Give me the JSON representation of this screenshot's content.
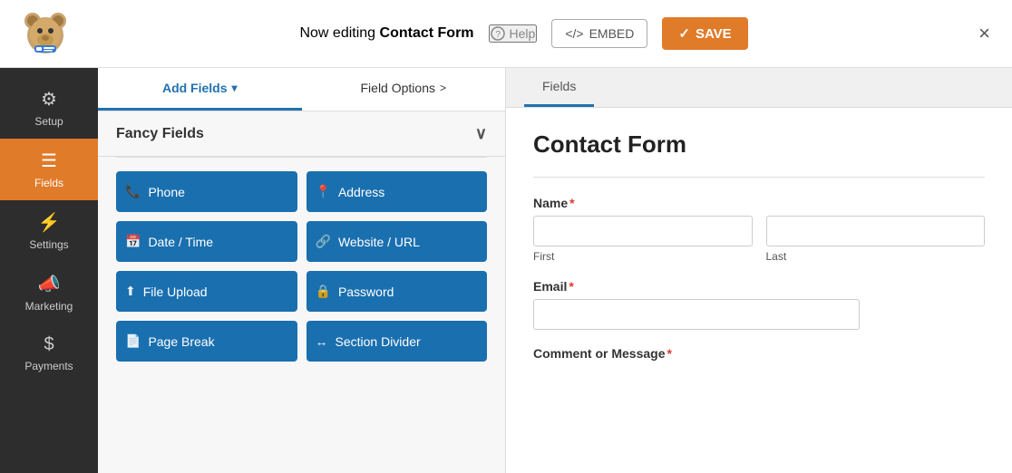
{
  "header": {
    "editing_prefix": "Now editing ",
    "form_name": "Contact Form",
    "help_label": "Help",
    "embed_label": "EMBED",
    "save_label": "SAVE",
    "close_label": "×"
  },
  "sidebar": {
    "items": [
      {
        "id": "setup",
        "label": "Setup",
        "icon": "⚙"
      },
      {
        "id": "fields",
        "label": "Fields",
        "icon": "☰",
        "active": true
      },
      {
        "id": "settings",
        "label": "Settings",
        "icon": "⚡"
      },
      {
        "id": "marketing",
        "label": "Marketing",
        "icon": "📣"
      },
      {
        "id": "payments",
        "label": "Payments",
        "icon": "$"
      }
    ]
  },
  "center": {
    "tabs": [
      {
        "id": "add-fields",
        "label": "Add Fields",
        "chevron": "▾",
        "active": true
      },
      {
        "id": "field-options",
        "label": "Field Options",
        "chevron": ">",
        "active": false
      }
    ],
    "section_label": "Fancy Fields",
    "fields": [
      [
        {
          "id": "phone",
          "icon": "📞",
          "label": "Phone"
        },
        {
          "id": "address",
          "icon": "📍",
          "label": "Address"
        }
      ],
      [
        {
          "id": "datetime",
          "icon": "📅",
          "label": "Date / Time"
        },
        {
          "id": "website",
          "icon": "🔗",
          "label": "Website / URL"
        }
      ],
      [
        {
          "id": "file-upload",
          "icon": "⬆",
          "label": "File Upload"
        },
        {
          "id": "password",
          "icon": "🔒",
          "label": "Password"
        }
      ],
      [
        {
          "id": "page-break",
          "icon": "📄",
          "label": "Page Break"
        },
        {
          "id": "section-divider",
          "icon": "↔",
          "label": "Section Divider"
        }
      ]
    ]
  },
  "preview": {
    "tab_label": "Fields",
    "form_title": "Contact Form",
    "fields": [
      {
        "id": "name",
        "label": "Name",
        "required": true,
        "type": "name",
        "sub_labels": [
          "First",
          "Last"
        ]
      },
      {
        "id": "email",
        "label": "Email",
        "required": true,
        "type": "email"
      },
      {
        "id": "comment",
        "label": "Comment or Message",
        "required": true,
        "type": "textarea"
      }
    ]
  }
}
